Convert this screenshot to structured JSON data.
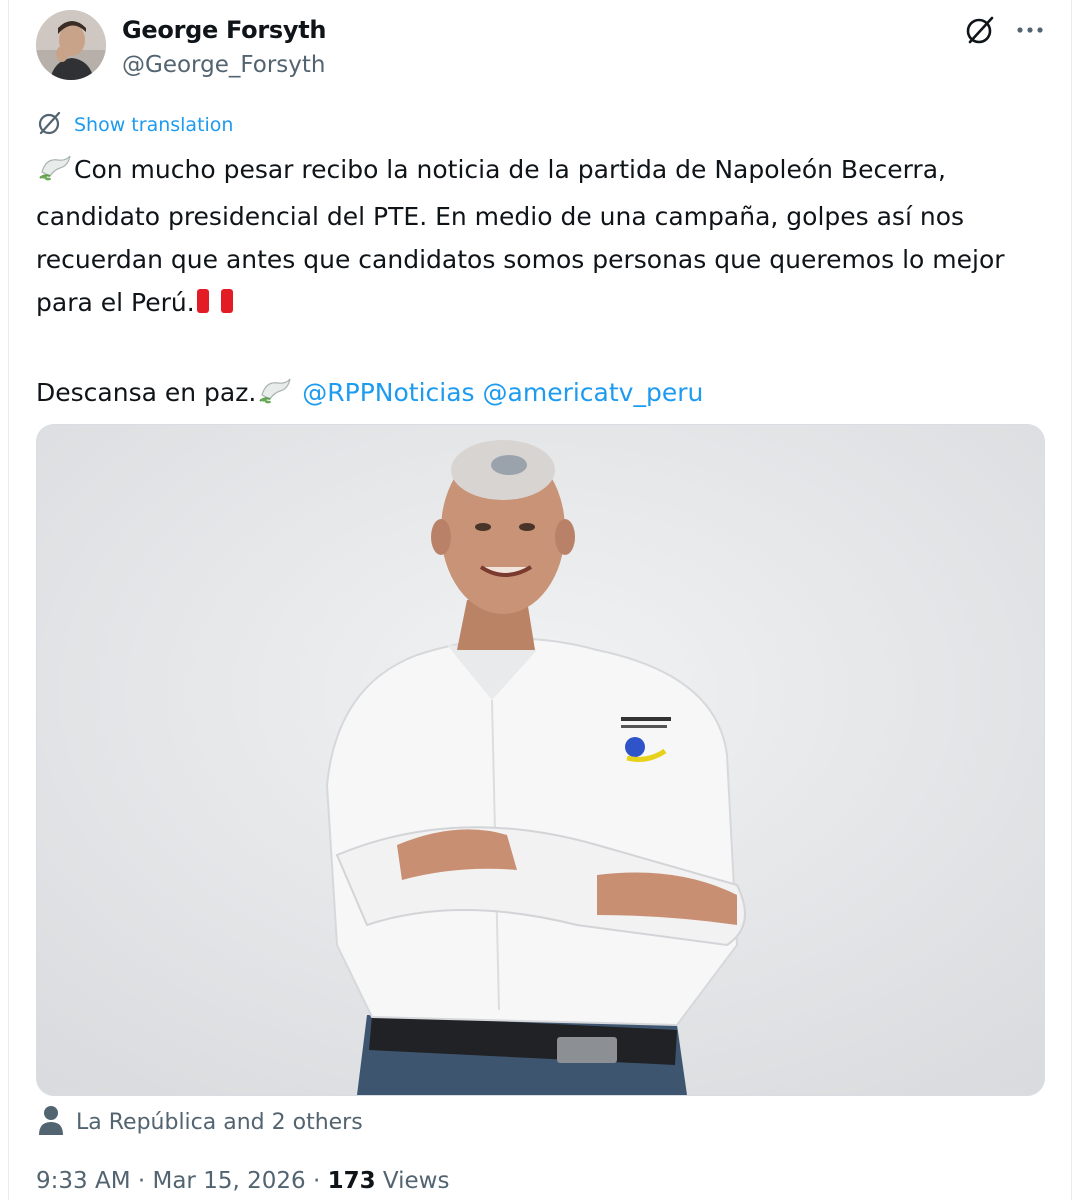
{
  "author": {
    "name": "George Forsyth",
    "handle": "@George_Forsyth"
  },
  "icons": {
    "grok": "grok-icon",
    "more": "more-icon",
    "translate": "translate-icon",
    "person": "person-icon"
  },
  "translate": {
    "label": "Show translation"
  },
  "tweet": {
    "para1": "Con mucho pesar recibo la noticia de la partida de Napoleón Becerra, candidato presidencial del PTE. En medio de una campaña, golpes así nos recuerdan que antes que candidatos somos personas que queremos lo mejor para el Perú.",
    "para2": "Descansa en paz.",
    "mentions": [
      "@RPPNoticias",
      "@americatv_peru"
    ]
  },
  "tagged": {
    "label": "La República and 2 others"
  },
  "meta": {
    "time": "9:33 AM",
    "date": "Mar 15, 2026",
    "views_count": "173",
    "views_label": "Views"
  },
  "colors": {
    "link": "#1d9bf0",
    "secondary_text": "#536471",
    "primary_text": "#0f1419"
  }
}
